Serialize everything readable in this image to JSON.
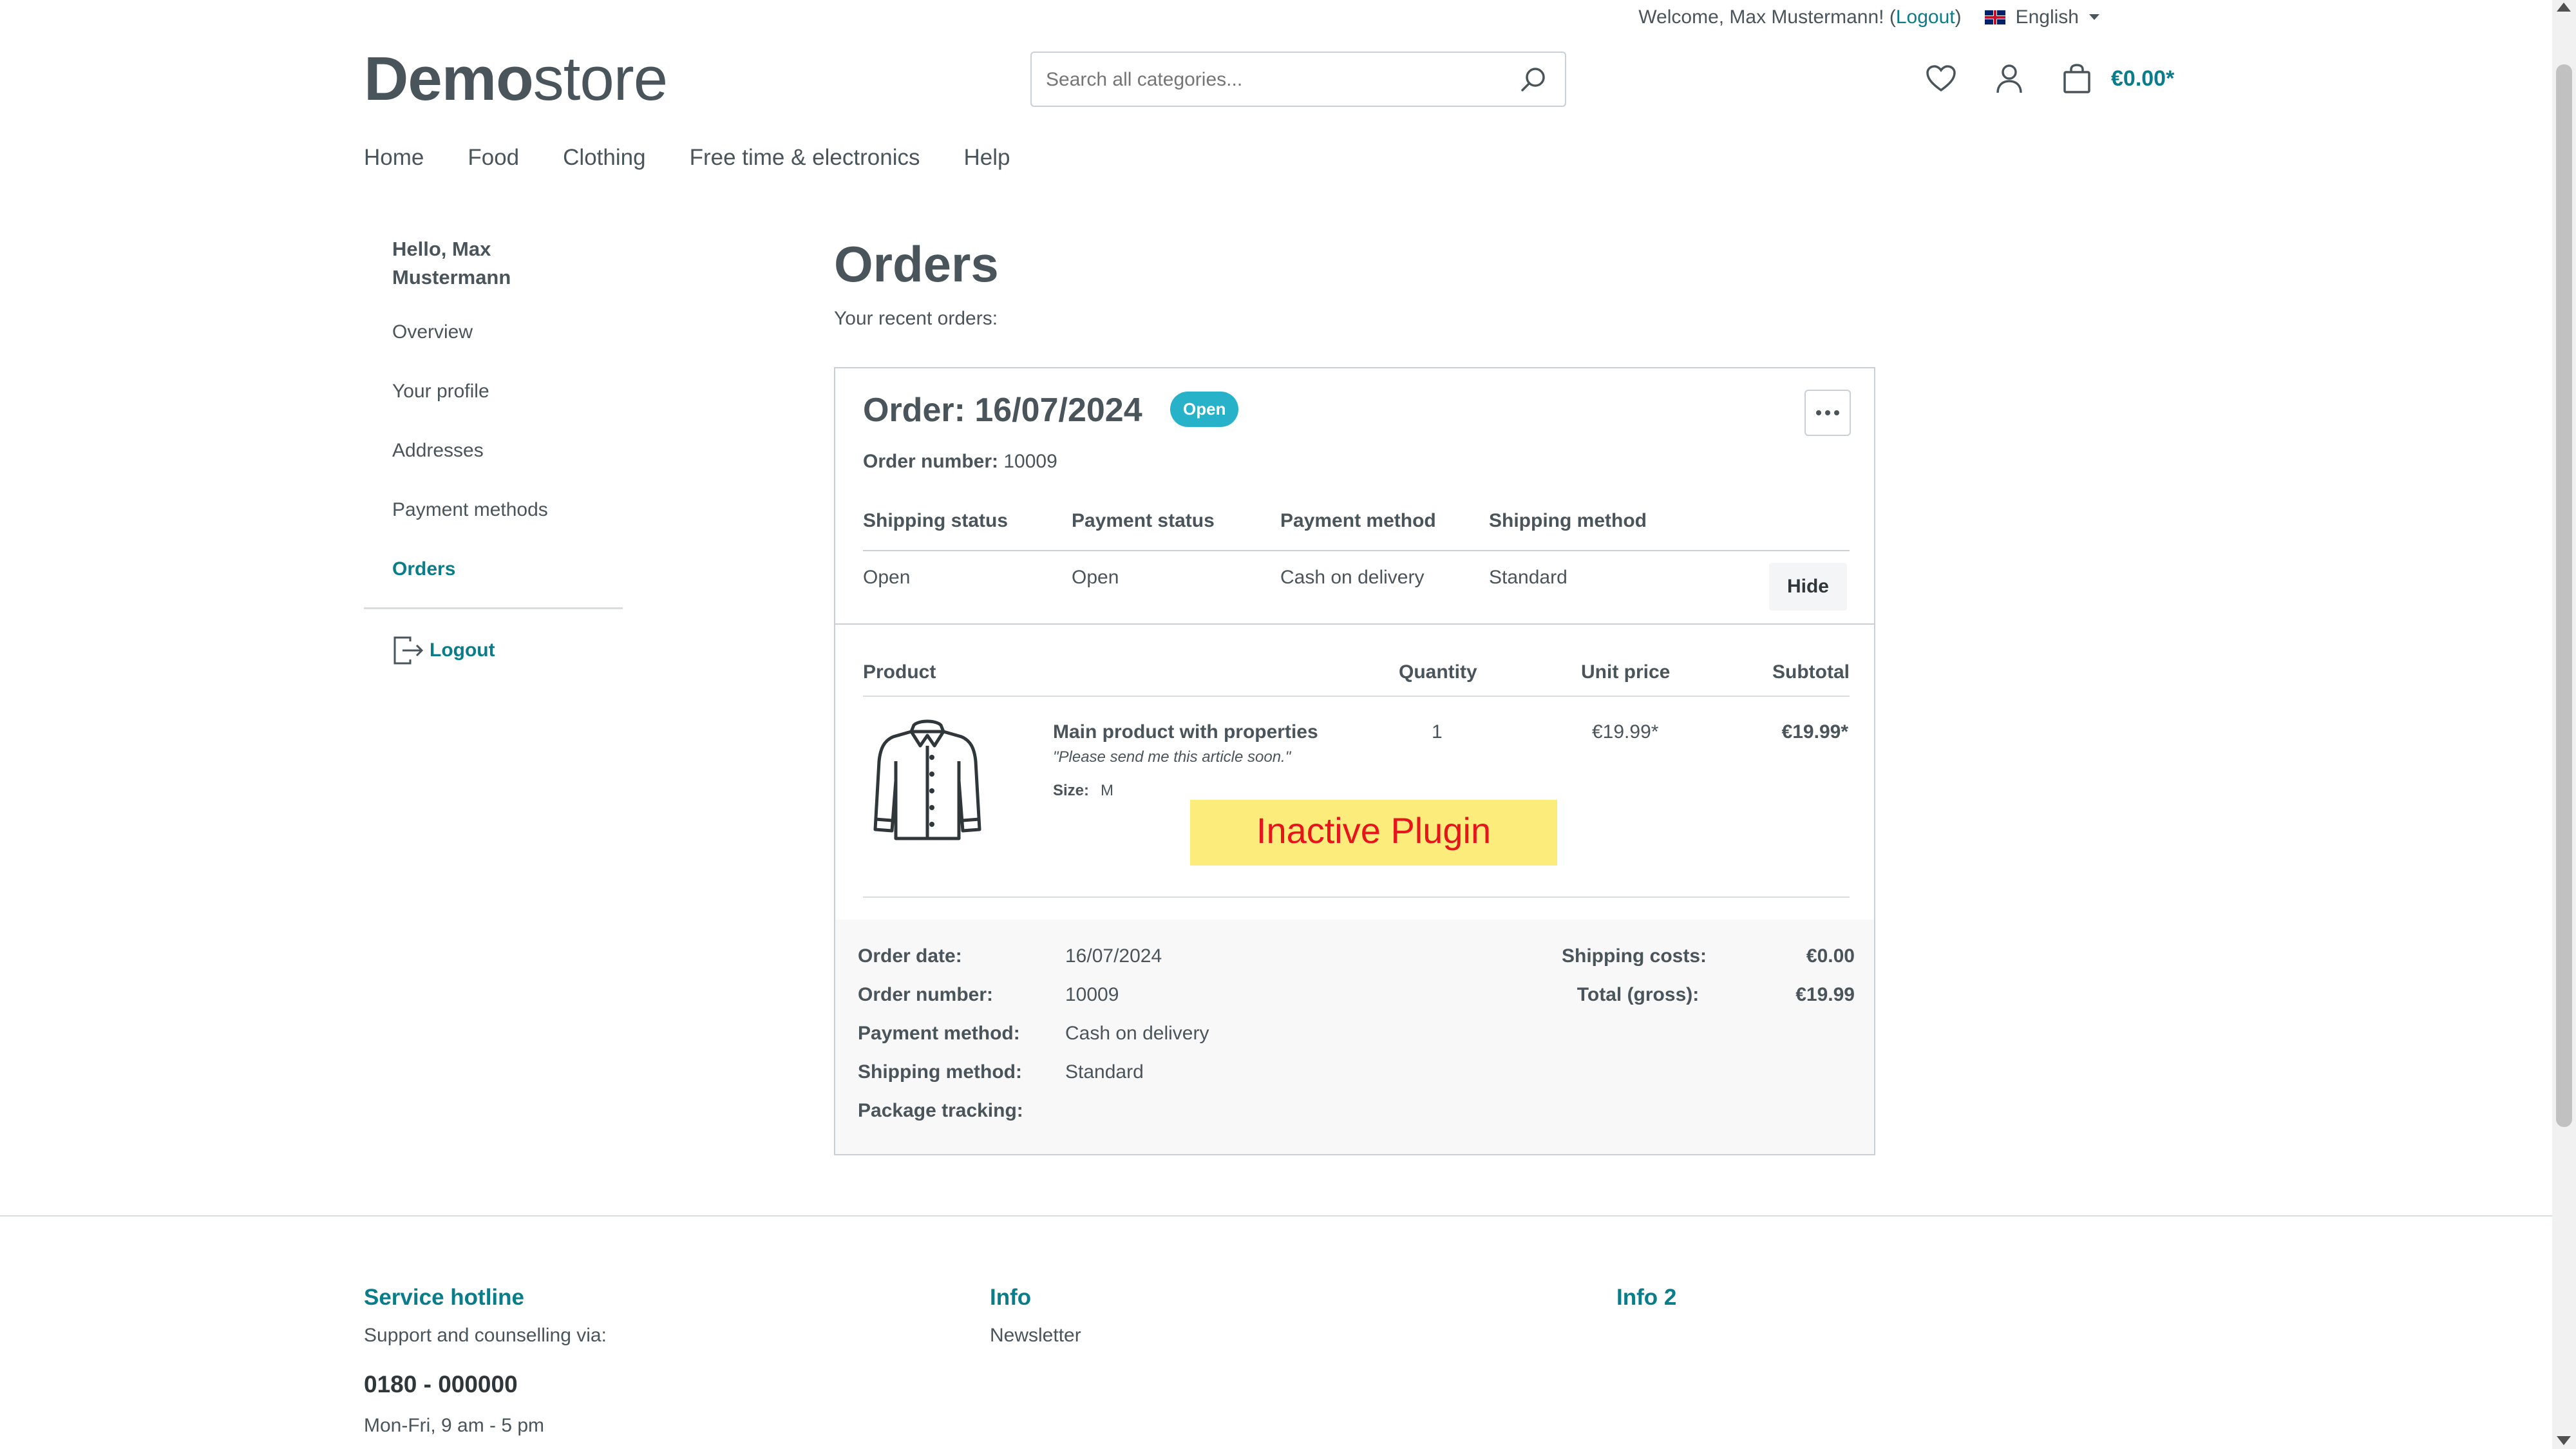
{
  "topbar": {
    "welcome": "Welcome, Max Mustermann! (",
    "logout_link": "Logout",
    "close_paren": ")",
    "language": "English"
  },
  "header": {
    "logo_bold": "Demo",
    "logo_light": "store",
    "search_placeholder": "Search all categories...",
    "cart_total": "€0.00*"
  },
  "nav": {
    "items": [
      "Home",
      "Food",
      "Clothing",
      "Free time & electronics",
      "Help"
    ]
  },
  "sidebar": {
    "greeting": "Hello, Max Mustermann",
    "items": [
      "Overview",
      "Your profile",
      "Addresses",
      "Payment methods",
      "Orders"
    ],
    "active": "Orders",
    "logout": "Logout"
  },
  "main": {
    "title": "Orders",
    "subtitle": "Your recent orders:"
  },
  "order": {
    "heading": "Order: 16/07/2024",
    "badge": "Open",
    "number_label": "Order number:",
    "number": "10009",
    "status_headers": [
      "Shipping status",
      "Payment status",
      "Payment method",
      "Shipping method"
    ],
    "status_values": [
      "Open",
      "Open",
      "Cash on delivery",
      "Standard"
    ],
    "hide_label": "Hide",
    "product_headers": {
      "product": "Product",
      "quantity": "Quantity",
      "unit_price": "Unit price",
      "subtotal": "Subtotal"
    },
    "item": {
      "name": "Main product with properties",
      "comment": "\"Please send me this article soon.\"",
      "size_label": "Size:",
      "size_value": "M",
      "quantity": "1",
      "unit_price": "€19.99*",
      "subtotal": "€19.99*",
      "image_icon": "jacket-icon"
    },
    "plugin_text": "Inactive Plugin",
    "summary_left": [
      {
        "k": "Order date:",
        "v": "16/07/2024"
      },
      {
        "k": "Order number:",
        "v": "10009"
      },
      {
        "k": "Payment method:",
        "v": "Cash on delivery"
      },
      {
        "k": "Shipping method:",
        "v": "Standard"
      },
      {
        "k": "Package tracking:",
        "v": ""
      }
    ],
    "summary_right": [
      {
        "k": "Shipping costs:",
        "v": "€0.00"
      },
      {
        "k": "Total (gross):",
        "v": "€19.99"
      }
    ]
  },
  "footer": {
    "hotline_title": "Service hotline",
    "hotline_text": "Support and counselling via:",
    "phone": "0180 - 000000",
    "hours": "Mon-Fri, 9 am - 5 pm",
    "info_title": "Info",
    "info_link": "Newsletter",
    "info2_title": "Info 2"
  },
  "colors": {
    "accent": "#0b7d8a",
    "badge": "#27b2c9",
    "plugin_bg": "#fcec7b",
    "plugin_text": "#e8141c"
  }
}
